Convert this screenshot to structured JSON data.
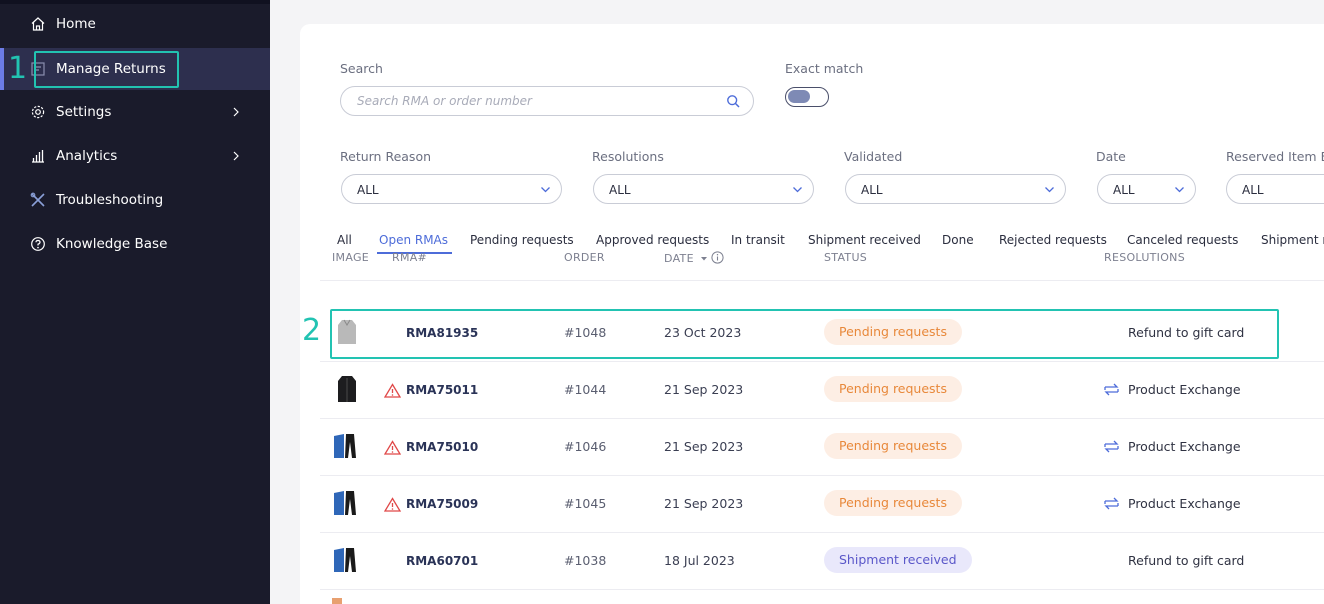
{
  "sidebar": {
    "items": [
      {
        "label": "Home",
        "icon": "home-icon"
      },
      {
        "label": "Manage Returns",
        "icon": "returns-icon"
      },
      {
        "label": "Settings",
        "icon": "gear-icon"
      },
      {
        "label": "Analytics",
        "icon": "bar-chart-icon"
      },
      {
        "label": "Troubleshooting",
        "icon": "tools-icon"
      },
      {
        "label": "Knowledge Base",
        "icon": "help-circle-icon"
      }
    ]
  },
  "annotations": {
    "first": "1",
    "second": "2",
    "color": "#22c3b2"
  },
  "filters": {
    "search_label": "Search",
    "search_placeholder": "Search RMA or order number",
    "exact_match_label": "Exact match",
    "return_reason_label": "Return Reason",
    "return_reason_value": "ALL",
    "resolutions_label": "Resolutions",
    "resolutions_value": "ALL",
    "validated_label": "Validated",
    "validated_value": "ALL",
    "date_label": "Date",
    "date_value": "ALL",
    "reserved_label": "Reserved Item Ex",
    "reserved_value": "ALL"
  },
  "tabs": [
    "All",
    "Open RMAs",
    "Pending requests",
    "Approved requests",
    "In transit",
    "Shipment received",
    "Done",
    "Rejected requests",
    "Canceled requests",
    "Shipment re"
  ],
  "table": {
    "headers": {
      "image": "IMAGE",
      "rma": "RMA#",
      "order": "ORDER",
      "date": "DATE",
      "status": "STATUS",
      "resolutions": "RESOLUTIONS"
    },
    "rows": [
      {
        "rma": "RMA81935",
        "order": "#1048",
        "date": "23 Oct 2023",
        "status": "Pending requests",
        "resolution": "Refund to gift card"
      },
      {
        "rma": "RMA75011",
        "order": "#1044",
        "date": "21 Sep 2023",
        "status": "Pending requests",
        "resolution": "Product Exchange"
      },
      {
        "rma": "RMA75010",
        "order": "#1046",
        "date": "21 Sep 2023",
        "status": "Pending requests",
        "resolution": "Product Exchange"
      },
      {
        "rma": "RMA75009",
        "order": "#1045",
        "date": "21 Sep 2023",
        "status": "Pending requests",
        "resolution": "Product Exchange"
      },
      {
        "rma": "RMA60701",
        "order": "#1038",
        "date": "18 Jul 2023",
        "status": "Shipment received",
        "resolution": "Refund to gift card"
      }
    ]
  },
  "colors": {
    "sidebar_bg": "#1a1b2b",
    "accent": "#4d6cd9",
    "pending_bg": "#fdeee4",
    "pending_text": "#e8883a",
    "shipment_bg": "#e9e8fb",
    "shipment_text": "#5a57c9"
  }
}
